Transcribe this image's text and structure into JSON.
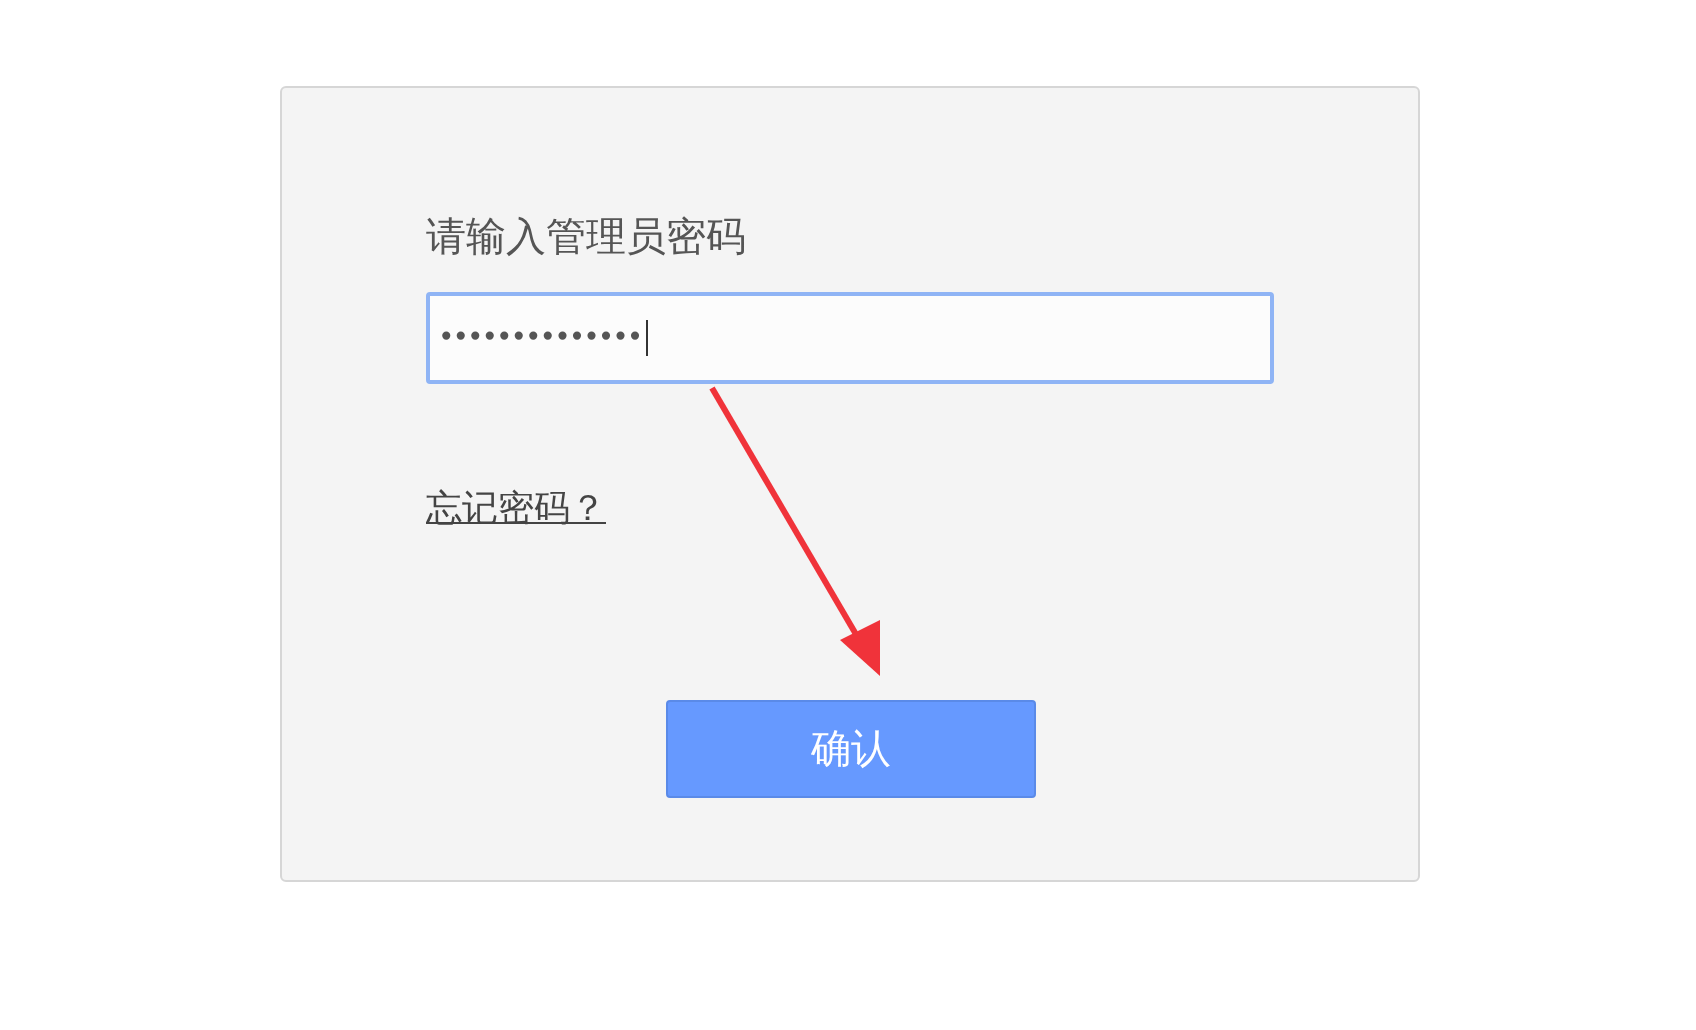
{
  "login": {
    "prompt": "请输入管理员密码",
    "password": {
      "value": "••••••••••••••",
      "focused": true
    },
    "forgot_link": "忘记密码？",
    "confirm_button": "确认"
  }
}
